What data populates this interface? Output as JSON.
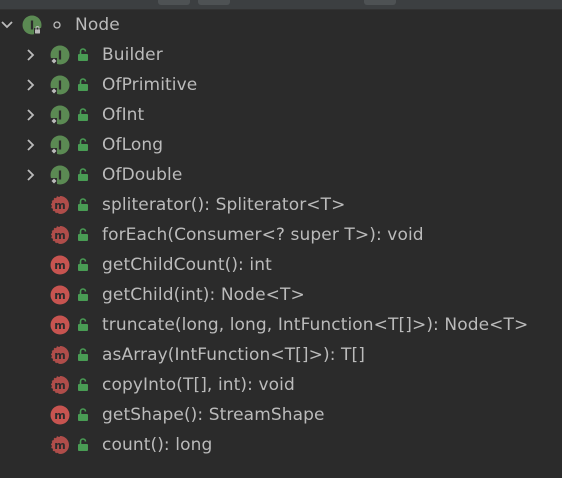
{
  "theme": {
    "background": "#2b2b2b",
    "text": "#bbbbbb",
    "interface_icon": "#5b8a53",
    "method_icon": "#c75450",
    "unlock_green": "#499c54"
  },
  "tree": {
    "root": {
      "label": "Node",
      "expanded": true,
      "icon": "interface-icon",
      "modifier": "package-private-dot-icon"
    },
    "children": [
      {
        "label": "Builder",
        "kind": "interface",
        "expandable": true,
        "abstract": false
      },
      {
        "label": "OfPrimitive",
        "kind": "interface",
        "expandable": true,
        "abstract": false
      },
      {
        "label": "OfInt",
        "kind": "interface",
        "expandable": true,
        "abstract": false
      },
      {
        "label": "OfLong",
        "kind": "interface",
        "expandable": true,
        "abstract": false
      },
      {
        "label": "OfDouble",
        "kind": "interface",
        "expandable": true,
        "abstract": false
      },
      {
        "label": "spliterator(): Spliterator<T>",
        "kind": "method",
        "expandable": false,
        "abstract": true
      },
      {
        "label": "forEach(Consumer<? super T>): void",
        "kind": "method",
        "expandable": false,
        "abstract": true
      },
      {
        "label": "getChildCount(): int",
        "kind": "method",
        "expandable": false,
        "abstract": false
      },
      {
        "label": "getChild(int): Node<T>",
        "kind": "method",
        "expandable": false,
        "abstract": false
      },
      {
        "label": "truncate(long, long, IntFunction<T[]>): Node<T>",
        "kind": "method",
        "expandable": false,
        "abstract": false
      },
      {
        "label": "asArray(IntFunction<T[]>): T[]",
        "kind": "method",
        "expandable": false,
        "abstract": true
      },
      {
        "label": "copyInto(T[], int): void",
        "kind": "method",
        "expandable": false,
        "abstract": true
      },
      {
        "label": "getShape(): StreamShape",
        "kind": "method",
        "expandable": false,
        "abstract": false
      },
      {
        "label": "count(): long",
        "kind": "method",
        "expandable": false,
        "abstract": true
      }
    ]
  }
}
